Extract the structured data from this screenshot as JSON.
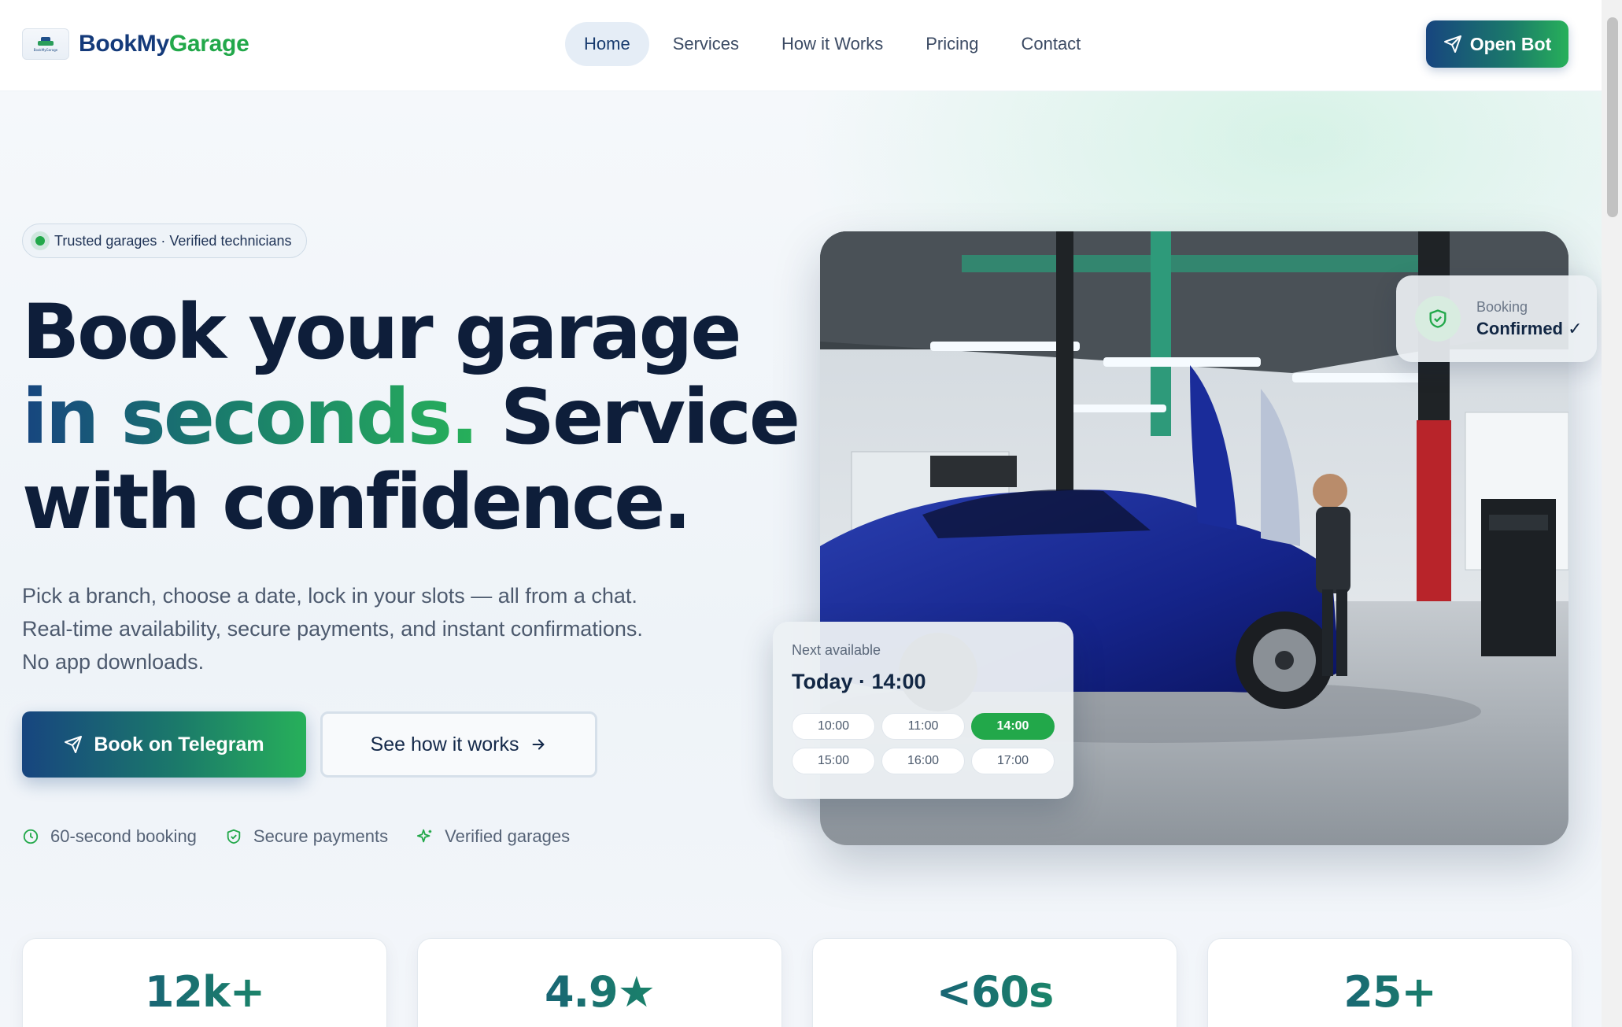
{
  "header": {
    "brand_part1": "BookMy",
    "brand_part2": "Garage",
    "logo_text": "BookMyGarage",
    "nav": [
      "Home",
      "Services",
      "How it Works",
      "Pricing",
      "Contact"
    ],
    "active_nav": "Home",
    "cta_label": "Open Bot"
  },
  "hero": {
    "pill_text": "Trusted garages · Verified technicians",
    "headline_line1": "Book your garage",
    "headline_highlight": "in seconds.",
    "headline_rest": " Service",
    "headline_line3": "with confidence.",
    "subcopy_line1": "Pick a branch, choose a date, lock in your slots — all from a chat.",
    "subcopy_line2": "Real-time availability, secure payments, and instant confirmations.",
    "subcopy_line3": "No app downloads.",
    "primary_button": "Book on Telegram",
    "secondary_button": "See how it works",
    "features": [
      "60-second booking",
      "Secure payments",
      "Verified garages"
    ]
  },
  "booking_badge": {
    "label": "Booking",
    "value": "Confirmed ✓"
  },
  "slots_card": {
    "label": "Next available",
    "title": "Today · 14:00",
    "slots": [
      "10:00",
      "11:00",
      "14:00",
      "15:00",
      "16:00",
      "17:00"
    ],
    "selected_slot": "14:00"
  },
  "stats": [
    {
      "value": "12k+"
    },
    {
      "value": "4.9★"
    },
    {
      "value": "<60s"
    },
    {
      "value": "25+"
    }
  ],
  "colors": {
    "brand_blue": "#17457f",
    "brand_green": "#22a84a",
    "text_dark": "#0e1e3a"
  },
  "icons": {
    "cta": "send-icon",
    "secondary": "arrow-right-icon",
    "features": [
      "clock-icon",
      "shield-check-icon",
      "sparkle-icon"
    ],
    "badge": "shield-check-icon"
  }
}
